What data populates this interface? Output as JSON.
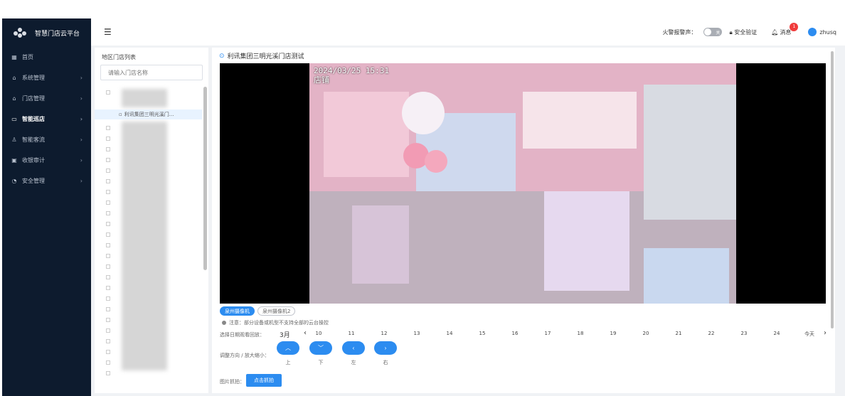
{
  "brand": {
    "title": "智慧门店云平台"
  },
  "nav": [
    {
      "label": "首页",
      "icon": "home-icon",
      "glyph": "▦",
      "arrow": false,
      "active": false
    },
    {
      "label": "系统管理",
      "icon": "system-icon",
      "glyph": "⌂",
      "arrow": true,
      "active": false
    },
    {
      "label": "门店管理",
      "icon": "store-icon",
      "glyph": "⌂",
      "arrow": true,
      "active": false
    },
    {
      "label": "智能巡店",
      "icon": "camera-icon",
      "glyph": "▭",
      "arrow": true,
      "active": true
    },
    {
      "label": "智能客流",
      "icon": "people-icon",
      "glyph": "♙",
      "arrow": true,
      "active": false
    },
    {
      "label": "收银审计",
      "icon": "audit-icon",
      "glyph": "▣",
      "arrow": true,
      "active": false
    },
    {
      "label": "安全管理",
      "icon": "safety-icon",
      "glyph": "◔",
      "arrow": true,
      "active": false
    }
  ],
  "header": {
    "fire_alarm_label": "火警报警声：",
    "toggle_text": "关",
    "security_label": "安全验证",
    "messages_label": "消息",
    "messages_count": "1",
    "username": "zhusq"
  },
  "tree": {
    "title": "地区门店列表",
    "search_placeholder": "请输入门店名称",
    "selected_store": "利讯集团三明光溪门..."
  },
  "main": {
    "store_title": "利讯集团三明光溪门店测试",
    "osd_time": "2024/03/25 15:31",
    "osd_name": "店铺",
    "cameras": [
      "泉州摄像机",
      "泉州摄像机2"
    ],
    "notice": "注意：部分设备或机型不支持全部的云台操控",
    "date_label": "选择日期观看回放：",
    "month": "3月",
    "days": [
      "10",
      "11",
      "12",
      "13",
      "14",
      "15",
      "16",
      "17",
      "18",
      "19",
      "20",
      "21",
      "22",
      "23",
      "24"
    ],
    "today": "今天",
    "ptz_label": "调整方向 / 放大缩小：",
    "ptz": [
      {
        "caption": "上",
        "glyph": "︿",
        "icon": "chevron-up-icon"
      },
      {
        "caption": "下",
        "glyph": "﹀",
        "icon": "chevron-down-icon"
      },
      {
        "caption": "左",
        "glyph": "‹",
        "icon": "chevron-left-icon"
      },
      {
        "caption": "右",
        "glyph": "›",
        "icon": "chevron-right-icon"
      }
    ],
    "snapshot_label": "图片抓拍：",
    "snapshot_button": "点击抓拍"
  },
  "colors": {
    "sidebar": "#0d1b2e",
    "accent": "#2c8cf0",
    "badge": "#f03b3b"
  }
}
